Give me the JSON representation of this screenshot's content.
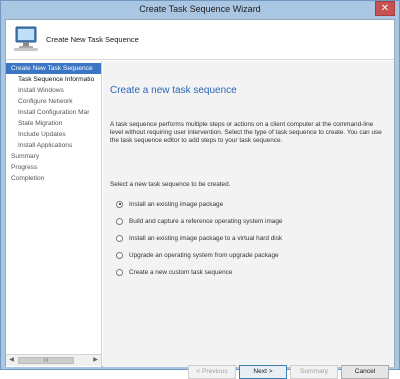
{
  "window": {
    "title": "Create Task Sequence Wizard",
    "close_label": "✕"
  },
  "header": {
    "title": "Create New Task Sequence",
    "icon": "computer-wizard-icon"
  },
  "nav": {
    "items": [
      {
        "label": "Create New Task Sequence"
      },
      {
        "label": "Task Sequence Informatio"
      },
      {
        "label": "Install Windows"
      },
      {
        "label": "Configure Network"
      },
      {
        "label": "Install Configuration Mar"
      },
      {
        "label": "State Migration"
      },
      {
        "label": "Include Updates"
      },
      {
        "label": "Install Applications"
      },
      {
        "label": "Summary"
      },
      {
        "label": "Progress"
      },
      {
        "label": "Completion"
      }
    ],
    "scroll_left": "◀",
    "scroll_right": "▶",
    "scroll_grip": "III"
  },
  "main": {
    "heading": "Create a new task sequence",
    "description": "A task sequence performs multiple steps or actions on a client computer at the command-line level without requiring user intervention. Select the type of task sequence to create. You can use the task sequence editor to add steps to your task sequence.",
    "prompt": "Select a new task sequence to be created.",
    "options": [
      {
        "label": "Install an existing image package",
        "selected": true
      },
      {
        "label": "Build and capture a reference operating system image",
        "selected": false
      },
      {
        "label": "Install an existing image package to a virtual hard disk",
        "selected": false
      },
      {
        "label": "Upgrade an operating system from upgrade package",
        "selected": false
      },
      {
        "label": "Create a new custom task sequence",
        "selected": false
      }
    ]
  },
  "buttons": {
    "previous": "< Previous",
    "next": "Next >",
    "summary": "Summary",
    "cancel": "Cancel"
  },
  "colors": {
    "accent": "#3a76c4",
    "heading": "#2b66b6",
    "titlebar": "#a9c6e2",
    "close": "#c75050"
  }
}
